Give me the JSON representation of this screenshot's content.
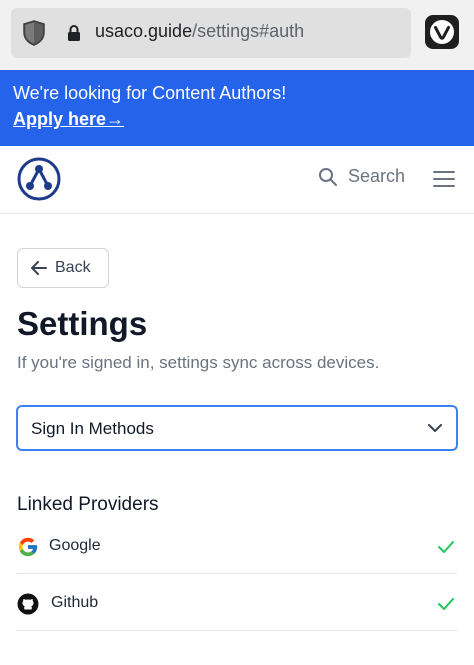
{
  "browser": {
    "url_domain": "usaco.guide",
    "url_path": "/settings#auth",
    "shield_icon": "shield-icon",
    "lock_icon": "lock-icon",
    "browser_icon": "vivaldi-icon"
  },
  "banner": {
    "message": "We're looking for Content Authors!",
    "link_label": "Apply here→",
    "color": "#2563eb"
  },
  "header": {
    "logo_icon": "usaco-guide-logo",
    "search_label": "Search",
    "menu_icon": "hamburger-menu-icon"
  },
  "main": {
    "back_label": "Back",
    "title": "Settings",
    "subtitle": "If you're signed in, settings sync across devices.",
    "section_select": {
      "selected": "Sign In Methods",
      "accent": "#3b82f6"
    },
    "linked_providers": {
      "title": "Linked Providers",
      "items": [
        {
          "label": "Google",
          "icon": "google-icon",
          "linked": true
        },
        {
          "label": "Github",
          "icon": "github-icon",
          "linked": true
        }
      ],
      "check_color": "#22c55e"
    }
  }
}
